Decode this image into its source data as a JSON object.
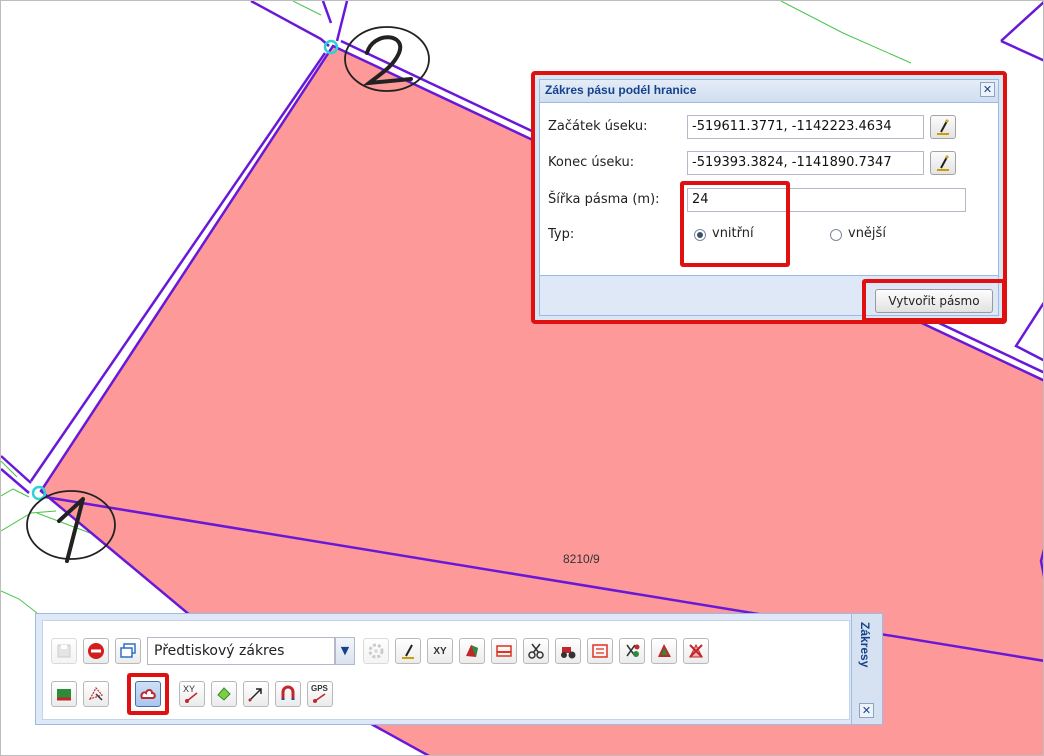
{
  "map": {
    "parcel_label": "8210/9",
    "parcel_fill": "#fd9999",
    "boundary_color": "#6a18d8",
    "neighbor_color": "#49c44a",
    "vertex_color": "#2bd2d6",
    "annotations": [
      "2",
      "1"
    ]
  },
  "dialog": {
    "title": "Zákres pásu podél hranice",
    "close_icon": "close-icon",
    "start_label": "Začátek úseku:",
    "start_value": "-519611.3771, -1142223.4634",
    "end_label": "Konec úseku:",
    "end_value": "-519393.3824, -1141890.7347",
    "width_label": "Šířka pásma (m):",
    "width_value": "24",
    "type_label": "Typ:",
    "type_options": [
      "vnitřní",
      "vnější"
    ],
    "type_selected": "vnitřní",
    "create_button": "Vytvořit pásmo",
    "highlight_color": "#e01010"
  },
  "toolbar": {
    "title": "Zákresy",
    "combo_value": "Předtiskový zákres",
    "xy_label": "XY",
    "xy_small_label": "XY",
    "gps_label": "GPS",
    "accent": "#15428b"
  }
}
